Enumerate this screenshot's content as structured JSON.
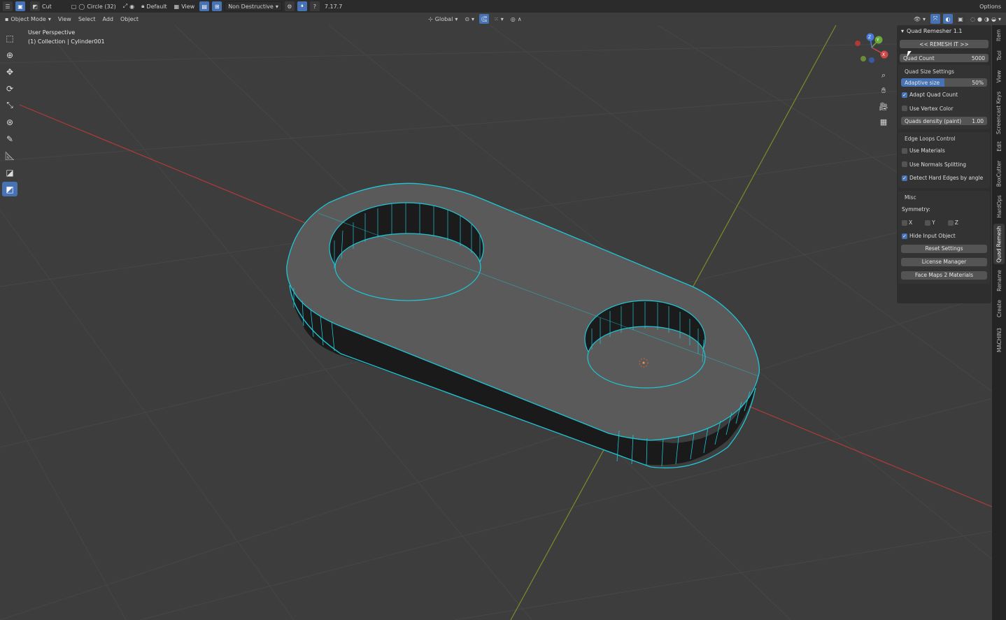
{
  "topbar": {
    "tool_name": "Cut",
    "shape": "Circle (32)",
    "snap_default": "Default",
    "view_label": "View",
    "mode_dropdown": "Non Destructive",
    "version": "7.17.7",
    "options": "Options"
  },
  "header": {
    "mode": "Object Mode",
    "menus": [
      "View",
      "Select",
      "Add",
      "Object"
    ],
    "orientation": "Global"
  },
  "viewport": {
    "perspective": "User Perspective",
    "collection": "(1) Collection | Cylinder001"
  },
  "gizmo": {
    "x": "X",
    "y": "Y",
    "z": "Z"
  },
  "panel": {
    "title": "Quad Remesher 1.1",
    "remesh_button": "<< REMESH IT >>",
    "quad_count_label": "Quad Count",
    "quad_count_value": "5000",
    "quad_size_header": "Quad Size Settings",
    "adaptive_label": "Adaptive size",
    "adaptive_value": "50%",
    "adaptive_fraction": 0.5,
    "adapt_quad_count": "Adapt Quad Count",
    "use_vertex_color": "Use Vertex Color",
    "quads_density_label": "Quads density (paint)",
    "quads_density_value": "1.00",
    "edge_loops_header": "Edge Loops Control",
    "use_materials": "Use Materials",
    "use_normals": "Use Normals Splitting",
    "detect_hard_edges": "Detect Hard Edges by angle",
    "misc_header": "Misc",
    "symmetry_label": "Symmetry:",
    "sym_x": "X",
    "sym_y": "Y",
    "sym_z": "Z",
    "hide_input": "Hide Input Object",
    "reset_settings": "Reset Settings",
    "license_manager": "License Manager",
    "face_maps": "Face Maps 2 Materials"
  },
  "tabs": [
    "Item",
    "Tool",
    "View",
    "Screencast Keys",
    "Edit",
    "BoxCutter",
    "HardOps",
    "Quad Remesh",
    "Rename",
    "Create",
    "MACHIN3"
  ],
  "colors": {
    "accent": "#4772b3",
    "wire": "#1fc6d6",
    "x_axis": "#c0403f",
    "y_axis": "#8f9a2a"
  }
}
